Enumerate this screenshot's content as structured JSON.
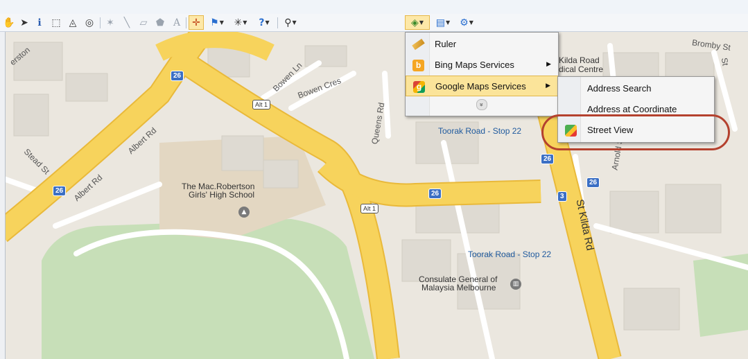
{
  "toolbar": {
    "buttons": [
      {
        "name": "pan-tool",
        "glyph": "✋"
      },
      {
        "name": "select-tool",
        "glyph": "➤"
      },
      {
        "name": "info-tool",
        "glyph": "ℹ"
      },
      {
        "name": "select-rectangle-tool",
        "glyph": "⬚"
      },
      {
        "name": "select-polygon-tool",
        "glyph": "◬"
      },
      {
        "name": "select-radius-tool",
        "glyph": "◎"
      },
      {
        "name": "draw-point-tool",
        "glyph": "✶"
      },
      {
        "name": "draw-line-tool",
        "glyph": "╲"
      },
      {
        "name": "draw-polygon-tool",
        "glyph": "▱"
      },
      {
        "name": "draw-shape-tool",
        "glyph": "⬟"
      },
      {
        "name": "draw-text-tool",
        "glyph": "A"
      },
      {
        "name": "add-point-tool",
        "glyph": "✛"
      },
      {
        "name": "flag-tool",
        "glyph": "⚑"
      },
      {
        "name": "sparkle-tool",
        "glyph": "✳"
      },
      {
        "name": "help-tool",
        "glyph": "?"
      },
      {
        "name": "find-tool",
        "glyph": "⚲"
      },
      {
        "name": "web-services-tool",
        "glyph": "◈"
      },
      {
        "name": "layers-tool",
        "glyph": "▤"
      },
      {
        "name": "settings-tool",
        "glyph": "⚙"
      }
    ]
  },
  "map": {
    "labels": {
      "street_ernston": "erston",
      "street_bowen_ln": "Bowen Ln",
      "street_bowen_cres": "Bowen Cres",
      "street_queens_rd": "Queens Rd",
      "street_albert_rd_1": "Albert Rd",
      "street_albert_rd_2": "Albert Rd",
      "street_stead_st": "Stead St",
      "street_bromby_st": "Bromby St",
      "street_st": "St",
      "street_arnold_st": "Arnold St",
      "street_st_kilda_rd": "St Kilda Rd",
      "stop_top": "Toorak Road - Stop 22",
      "stop_bottom": "Toorak Road - Stop 22",
      "school_line1": "The Mac.Robertson",
      "school_line2": "Girls' High School",
      "consulate_line1": "Consulate General of",
      "consulate_line2": "Malaysia Melbourne",
      "centre_line1": "Kilda Road",
      "centre_line2": "dical Centre"
    },
    "shields": {
      "r26_a": "26",
      "r26_b": "26",
      "r26_c": "26",
      "r26_d": "26",
      "r26_e": "26",
      "r3": "3"
    },
    "alt": {
      "a": "Alt 1",
      "b": "Alt 1"
    },
    "colors": {
      "road": "#f7d35c",
      "road_edge": "#e9b93a",
      "park": "#c7dfb8",
      "land": "#ebe7df",
      "building": "#dedad2"
    }
  },
  "menu": {
    "items": [
      {
        "label": "Ruler",
        "icon": "ruler-icon"
      },
      {
        "label": "Bing Maps Services",
        "icon": "bing-icon",
        "submenu": true
      },
      {
        "label": "Google Maps Services",
        "icon": "google-icon",
        "submenu": true,
        "highlighted": true
      }
    ],
    "expand_glyph": "»"
  },
  "submenu": {
    "items": [
      {
        "label": "Address Search"
      },
      {
        "label": "Address at Coordinate"
      },
      {
        "label": "Street View",
        "icon": "street-view-icon"
      }
    ]
  }
}
